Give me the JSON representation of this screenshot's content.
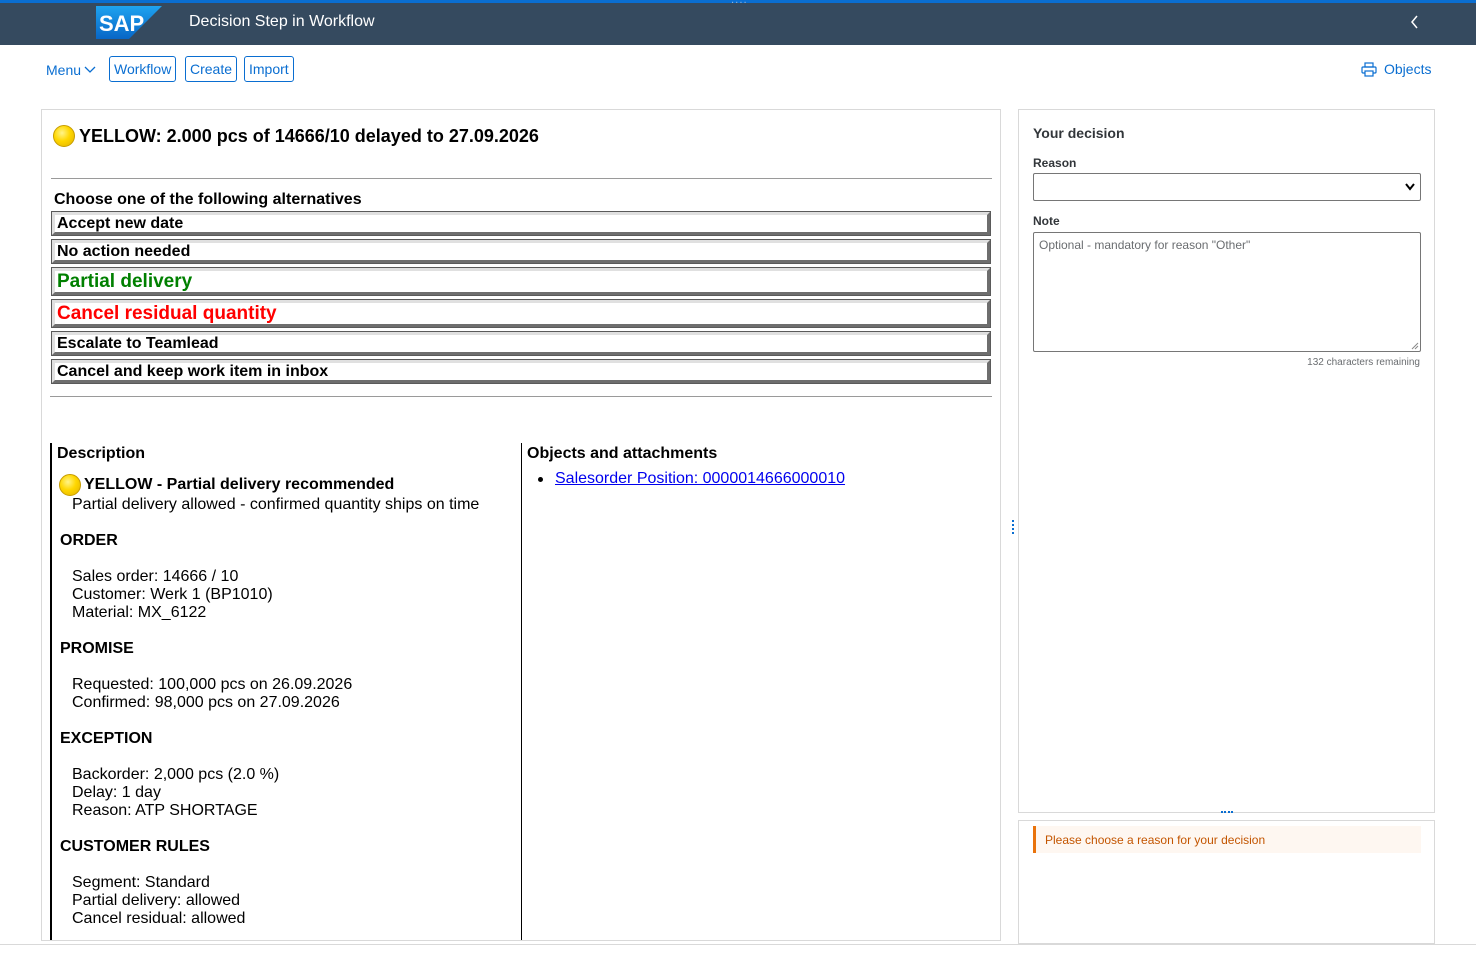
{
  "shell": {
    "logo_text": "SAP",
    "title": "Decision Step in Workflow",
    "grip": "····"
  },
  "toolbar": {
    "menu_label": "Menu",
    "buttons": [
      "Workflow",
      "Create",
      "Import"
    ],
    "objects_label": "Objects"
  },
  "decision": {
    "headline": "YELLOW: 2.000 pcs of 14666/10 delayed to 27.09.2026",
    "choose_label": "Choose one of the following alternatives",
    "alternatives": [
      {
        "label": "Accept new date",
        "color": "#000000"
      },
      {
        "label": "No action needed",
        "color": "#000000"
      },
      {
        "label": "Partial delivery",
        "color": "#008000"
      },
      {
        "label": "Cancel residual quantity",
        "color": "#ff0000"
      },
      {
        "label": "Escalate to Teamlead",
        "color": "#000000"
      },
      {
        "label": "Cancel and keep work item in inbox",
        "color": "#000000"
      }
    ]
  },
  "description": {
    "heading": "Description",
    "status_title": "YELLOW - Partial delivery recommended",
    "status_text": "Partial delivery allowed - confirmed quantity ships on time",
    "order": {
      "heading": "ORDER",
      "lines": [
        "Sales order: 14666 / 10",
        "Customer: Werk 1 (BP1010)",
        "Material: MX_6122"
      ]
    },
    "promise": {
      "heading": "PROMISE",
      "lines": [
        "Requested: 100,000 pcs on 26.09.2026",
        "Confirmed: 98,000 pcs on 27.09.2026"
      ]
    },
    "exception": {
      "heading": "EXCEPTION",
      "lines": [
        "Backorder: 2,000 pcs (2.0 %)",
        "Delay: 1 day",
        "Reason: ATP SHORTAGE"
      ]
    },
    "customer_rules": {
      "heading": "CUSTOMER RULES",
      "lines": [
        "Segment: Standard",
        "Partial delivery: allowed",
        "Cancel residual: allowed"
      ]
    }
  },
  "objects": {
    "heading": "Objects and attachments",
    "link": "Salesorder Position: 0000014666000010"
  },
  "your_decision": {
    "title": "Your decision",
    "reason_label": "Reason",
    "reason_value": "",
    "note_label": "Note",
    "note_placeholder": "Optional - mandatory for reason \"Other\"",
    "remaining": "132 characters remaining"
  },
  "message": {
    "text": "Please choose a reason for your decision"
  },
  "colors": {
    "shell_bg": "#354a5f",
    "accent": "#0a6ed1",
    "warning": "#e9730c",
    "status_yellow": "#ffd700"
  }
}
